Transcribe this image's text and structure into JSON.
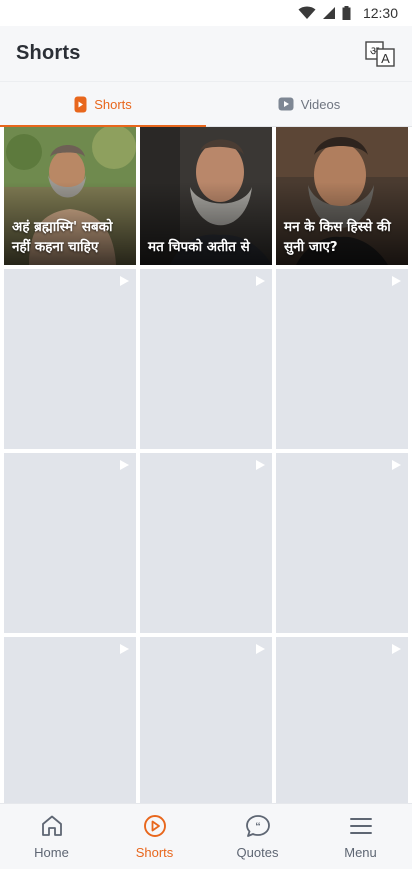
{
  "status": {
    "time": "12:30"
  },
  "header": {
    "title": "Shorts"
  },
  "tabs": [
    {
      "label": "Shorts",
      "active": true
    },
    {
      "label": "Videos",
      "active": false
    }
  ],
  "shorts": [
    {
      "caption": "अहं ब्रह्मास्मि' सबको नहीं कहना चाहिए"
    },
    {
      "caption": "मत चिपको अतीत से"
    },
    {
      "caption": "मन के किस हिस्से की सुनी जाए?"
    }
  ],
  "nav": [
    {
      "label": "Home",
      "icon": "home-icon",
      "active": false
    },
    {
      "label": "Shorts",
      "icon": "play-circle-icon",
      "active": true
    },
    {
      "label": "Quotes",
      "icon": "quote-bubble-icon",
      "active": false
    },
    {
      "label": "Menu",
      "icon": "menu-icon",
      "active": false
    }
  ],
  "colors": {
    "accent": "#e8671d",
    "placeholder": "#e1e4ea",
    "bar": "#f6f7f9"
  }
}
